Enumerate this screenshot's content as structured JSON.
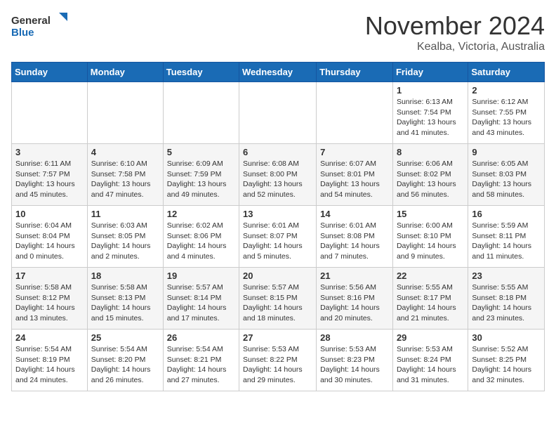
{
  "logo": {
    "text_general": "General",
    "text_blue": "Blue"
  },
  "header": {
    "month": "November 2024",
    "location": "Kealba, Victoria, Australia"
  },
  "weekdays": [
    "Sunday",
    "Monday",
    "Tuesday",
    "Wednesday",
    "Thursday",
    "Friday",
    "Saturday"
  ],
  "weeks": [
    [
      {
        "day": "",
        "info": ""
      },
      {
        "day": "",
        "info": ""
      },
      {
        "day": "",
        "info": ""
      },
      {
        "day": "",
        "info": ""
      },
      {
        "day": "",
        "info": ""
      },
      {
        "day": "1",
        "info": "Sunrise: 6:13 AM\nSunset: 7:54 PM\nDaylight: 13 hours\nand 41 minutes."
      },
      {
        "day": "2",
        "info": "Sunrise: 6:12 AM\nSunset: 7:55 PM\nDaylight: 13 hours\nand 43 minutes."
      }
    ],
    [
      {
        "day": "3",
        "info": "Sunrise: 6:11 AM\nSunset: 7:57 PM\nDaylight: 13 hours\nand 45 minutes."
      },
      {
        "day": "4",
        "info": "Sunrise: 6:10 AM\nSunset: 7:58 PM\nDaylight: 13 hours\nand 47 minutes."
      },
      {
        "day": "5",
        "info": "Sunrise: 6:09 AM\nSunset: 7:59 PM\nDaylight: 13 hours\nand 49 minutes."
      },
      {
        "day": "6",
        "info": "Sunrise: 6:08 AM\nSunset: 8:00 PM\nDaylight: 13 hours\nand 52 minutes."
      },
      {
        "day": "7",
        "info": "Sunrise: 6:07 AM\nSunset: 8:01 PM\nDaylight: 13 hours\nand 54 minutes."
      },
      {
        "day": "8",
        "info": "Sunrise: 6:06 AM\nSunset: 8:02 PM\nDaylight: 13 hours\nand 56 minutes."
      },
      {
        "day": "9",
        "info": "Sunrise: 6:05 AM\nSunset: 8:03 PM\nDaylight: 13 hours\nand 58 minutes."
      }
    ],
    [
      {
        "day": "10",
        "info": "Sunrise: 6:04 AM\nSunset: 8:04 PM\nDaylight: 14 hours\nand 0 minutes."
      },
      {
        "day": "11",
        "info": "Sunrise: 6:03 AM\nSunset: 8:05 PM\nDaylight: 14 hours\nand 2 minutes."
      },
      {
        "day": "12",
        "info": "Sunrise: 6:02 AM\nSunset: 8:06 PM\nDaylight: 14 hours\nand 4 minutes."
      },
      {
        "day": "13",
        "info": "Sunrise: 6:01 AM\nSunset: 8:07 PM\nDaylight: 14 hours\nand 5 minutes."
      },
      {
        "day": "14",
        "info": "Sunrise: 6:01 AM\nSunset: 8:08 PM\nDaylight: 14 hours\nand 7 minutes."
      },
      {
        "day": "15",
        "info": "Sunrise: 6:00 AM\nSunset: 8:10 PM\nDaylight: 14 hours\nand 9 minutes."
      },
      {
        "day": "16",
        "info": "Sunrise: 5:59 AM\nSunset: 8:11 PM\nDaylight: 14 hours\nand 11 minutes."
      }
    ],
    [
      {
        "day": "17",
        "info": "Sunrise: 5:58 AM\nSunset: 8:12 PM\nDaylight: 14 hours\nand 13 minutes."
      },
      {
        "day": "18",
        "info": "Sunrise: 5:58 AM\nSunset: 8:13 PM\nDaylight: 14 hours\nand 15 minutes."
      },
      {
        "day": "19",
        "info": "Sunrise: 5:57 AM\nSunset: 8:14 PM\nDaylight: 14 hours\nand 17 minutes."
      },
      {
        "day": "20",
        "info": "Sunrise: 5:57 AM\nSunset: 8:15 PM\nDaylight: 14 hours\nand 18 minutes."
      },
      {
        "day": "21",
        "info": "Sunrise: 5:56 AM\nSunset: 8:16 PM\nDaylight: 14 hours\nand 20 minutes."
      },
      {
        "day": "22",
        "info": "Sunrise: 5:55 AM\nSunset: 8:17 PM\nDaylight: 14 hours\nand 21 minutes."
      },
      {
        "day": "23",
        "info": "Sunrise: 5:55 AM\nSunset: 8:18 PM\nDaylight: 14 hours\nand 23 minutes."
      }
    ],
    [
      {
        "day": "24",
        "info": "Sunrise: 5:54 AM\nSunset: 8:19 PM\nDaylight: 14 hours\nand 24 minutes."
      },
      {
        "day": "25",
        "info": "Sunrise: 5:54 AM\nSunset: 8:20 PM\nDaylight: 14 hours\nand 26 minutes."
      },
      {
        "day": "26",
        "info": "Sunrise: 5:54 AM\nSunset: 8:21 PM\nDaylight: 14 hours\nand 27 minutes."
      },
      {
        "day": "27",
        "info": "Sunrise: 5:53 AM\nSunset: 8:22 PM\nDaylight: 14 hours\nand 29 minutes."
      },
      {
        "day": "28",
        "info": "Sunrise: 5:53 AM\nSunset: 8:23 PM\nDaylight: 14 hours\nand 30 minutes."
      },
      {
        "day": "29",
        "info": "Sunrise: 5:53 AM\nSunset: 8:24 PM\nDaylight: 14 hours\nand 31 minutes."
      },
      {
        "day": "30",
        "info": "Sunrise: 5:52 AM\nSunset: 8:25 PM\nDaylight: 14 hours\nand 32 minutes."
      }
    ]
  ]
}
